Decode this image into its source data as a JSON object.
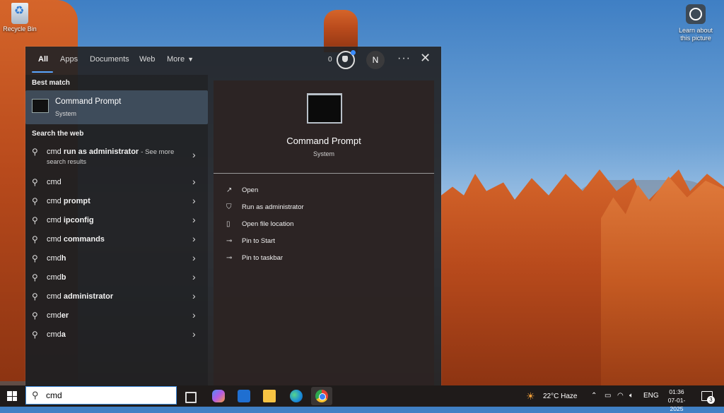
{
  "desktop": {
    "recycle_bin_label": "Recycle Bin",
    "learn_label": "Learn about this picture"
  },
  "tabs": [
    {
      "label": "All"
    },
    {
      "label": "Apps"
    },
    {
      "label": "Documents"
    },
    {
      "label": "Web"
    },
    {
      "label": "More"
    }
  ],
  "header": {
    "rewards_count": "0",
    "avatar_initial": "N",
    "more_options": "···",
    "close": "✕"
  },
  "best_match": {
    "section_title": "Best match",
    "title": "Command Prompt",
    "subtitle": "System"
  },
  "web": {
    "section_title": "Search the web",
    "first_query": {
      "typed": "cmd",
      "bold": "run as administrator",
      "see_more": "- See more",
      "sub": "search results"
    },
    "items": [
      {
        "typed": "cmd",
        "bold": ""
      },
      {
        "typed": "cmd",
        "bold": "prompt"
      },
      {
        "typed": "cmd",
        "bold": "ipconfig"
      },
      {
        "typed": "cmd",
        "bold": "commands"
      },
      {
        "typed": "cmd",
        "bold": "h"
      },
      {
        "typed": "cmd",
        "bold": "b"
      },
      {
        "typed": "cmd",
        "bold": "administrator"
      },
      {
        "typed": "cmd",
        "bold": "er"
      },
      {
        "typed": "cmd",
        "bold": "a"
      }
    ]
  },
  "preview": {
    "title": "Command Prompt",
    "subtitle": "System",
    "actions": [
      {
        "label": "Open",
        "icon": "open-icon"
      },
      {
        "label": "Run as administrator",
        "icon": "shield-icon"
      },
      {
        "label": "Open file location",
        "icon": "file-location-icon"
      },
      {
        "label": "Pin to Start",
        "icon": "pin-icon"
      },
      {
        "label": "Pin to taskbar",
        "icon": "pin-icon"
      }
    ]
  },
  "taskbar": {
    "search_value": "cmd",
    "weather": "22°C  Haze",
    "language": "ENG",
    "time": "01:36",
    "date": "07-01-2025",
    "notification_count": "3"
  }
}
